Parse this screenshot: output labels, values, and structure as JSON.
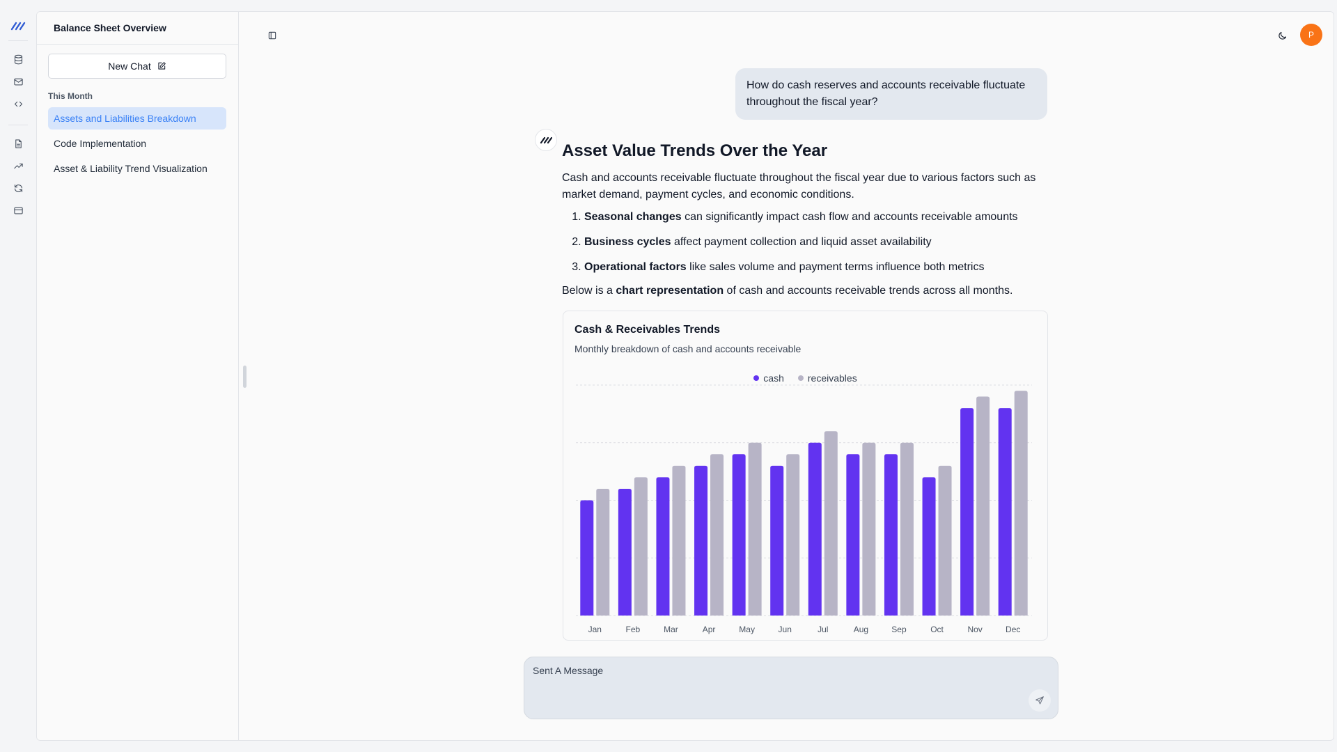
{
  "sidebar": {
    "title": "Balance Sheet Overview",
    "new_chat_label": "New Chat",
    "section_label": "This Month",
    "items": [
      {
        "label": "Assets and Liabilities Breakdown",
        "active": true
      },
      {
        "label": "Code Implementation",
        "active": false
      },
      {
        "label": "Asset & Liability Trend Visualization",
        "active": false
      }
    ]
  },
  "rail": {
    "icons": [
      "logo-icon",
      "database-icon",
      "mail-icon",
      "code-icon",
      "document-icon",
      "trending-up-icon",
      "refresh-icon",
      "credit-card-icon"
    ]
  },
  "header": {
    "avatar_initial": "P",
    "theme_icon": "moon-icon",
    "sidebar_toggle_icon": "sidebar-toggle-icon"
  },
  "conversation": {
    "user_message": "How do cash reserves and accounts receivable fluctuate throughout the fiscal year?",
    "answer": {
      "heading": "Asset Value Trends Over the Year",
      "intro": "Cash and accounts receivable fluctuate throughout the fiscal year due to various factors such as market demand, payment cycles, and economic conditions.",
      "list": [
        {
          "bold": "Seasonal changes",
          "rest": " can significantly impact cash flow and accounts receivable amounts"
        },
        {
          "bold": "Business cycles",
          "rest": " affect payment collection and liquid asset availability"
        },
        {
          "bold": "Operational factors",
          "rest": " like sales volume and payment terms influence both metrics"
        }
      ],
      "below_pre": "Below is a ",
      "below_bold": "chart representation",
      "below_post": " of cash and accounts receivable trends across all months."
    }
  },
  "chart_card": {
    "title": "Cash & Receivables Trends",
    "subtitle": "Monthly breakdown of cash and accounts receivable"
  },
  "chart_data": {
    "type": "bar",
    "categories": [
      "Jan",
      "Feb",
      "Mar",
      "Apr",
      "May",
      "Jun",
      "Jul",
      "Aug",
      "Sep",
      "Oct",
      "Nov",
      "Dec"
    ],
    "series": [
      {
        "name": "cash",
        "color": "#6233f0",
        "values": [
          20,
          22,
          24,
          26,
          28,
          26,
          30,
          28,
          28,
          24,
          36,
          36
        ]
      },
      {
        "name": "receivables",
        "color": "#b7b4c6",
        "values": [
          22,
          24,
          26,
          28,
          30,
          28,
          32,
          30,
          30,
          26,
          38,
          39
        ]
      }
    ],
    "ylim": [
      0,
      40
    ],
    "grid": true,
    "legend_position": "top-center"
  },
  "composer": {
    "placeholder": "Sent A Message",
    "send_icon": "send-icon"
  }
}
